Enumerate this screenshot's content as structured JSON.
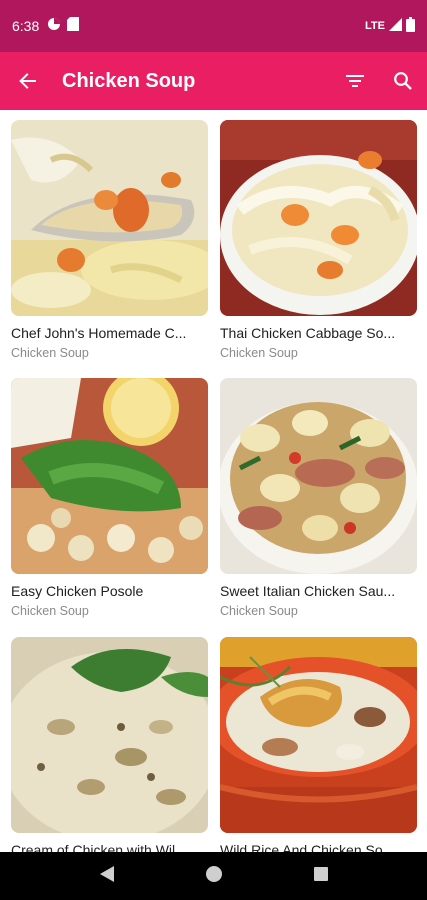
{
  "status": {
    "time": "6:38",
    "network": "LTE"
  },
  "appbar": {
    "title": "Chicken Soup"
  },
  "recipes": [
    {
      "name": "Chef John's Homemade C...",
      "category": "Chicken Soup"
    },
    {
      "name": "Thai Chicken Cabbage So...",
      "category": "Chicken Soup"
    },
    {
      "name": "Easy Chicken Posole",
      "category": "Chicken Soup"
    },
    {
      "name": "Sweet Italian Chicken Sau...",
      "category": "Chicken Soup"
    },
    {
      "name": "Cream of Chicken with Wil...",
      "category": ""
    },
    {
      "name": "Wild Rice And Chicken So...",
      "category": ""
    }
  ],
  "colors": {
    "statusbar": "#b0175c",
    "appbar": "#e91e63"
  }
}
